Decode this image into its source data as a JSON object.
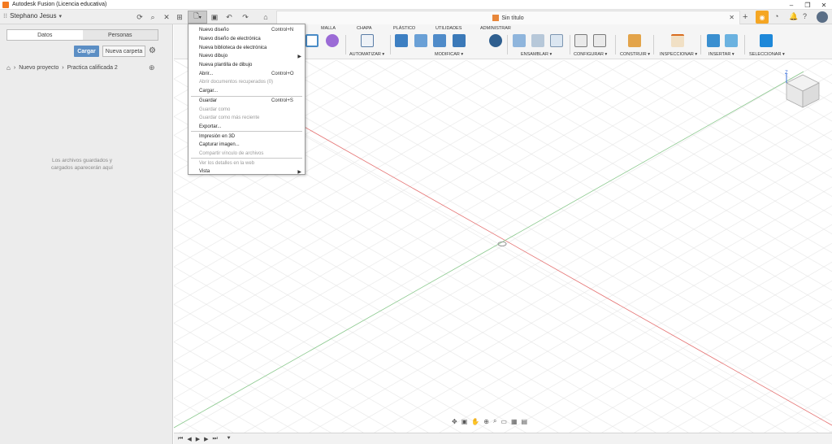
{
  "window": {
    "title": "Autodesk Fusion (Licencia educativa)"
  },
  "appbar": {
    "user_name": "Stephano Jesus",
    "document_title": "Sin título"
  },
  "data_panel": {
    "tabs": [
      "Datos",
      "Personas"
    ],
    "upload_label": "Cargar",
    "new_folder_label": "Nueva carpeta",
    "breadcrumb": [
      "Nuevo proyecto",
      "Practica calificada 2"
    ],
    "empty_message": "Los archivos guardados y cargados aparecerán aquí"
  },
  "toolbar": {
    "tabs": [
      "MALLA",
      "CHAPA",
      "PLÁSTICO",
      "UTILIDADES",
      "ADMINISTRAR"
    ],
    "groups": [
      "AUTOMATIZAR ▾",
      "MODIFICAR ▾",
      "ENSAMBLAR ▾",
      "CONFIGURAR ▾",
      "CONSTRUIR ▾",
      "INSPECCIONAR ▾",
      "INSERTAR ▾",
      "SELECCIONAR ▾"
    ]
  },
  "file_menu": {
    "items": [
      {
        "label": "Nuevo diseño",
        "shortcut": "Control+N",
        "disabled": false
      },
      {
        "label": "Nuevo diseño de electrónica",
        "shortcut": "",
        "disabled": false
      },
      {
        "label": "Nueva biblioteca de electrónica",
        "shortcut": "",
        "disabled": false
      },
      {
        "label": "Nuevo dibujo",
        "shortcut": "",
        "disabled": false,
        "submenu": true
      },
      {
        "label": "Nueva plantilla de dibujo",
        "shortcut": "",
        "disabled": false
      },
      {
        "label": "Abrir...",
        "shortcut": "Control+O",
        "disabled": false
      },
      {
        "label": "Abrir documentos recuperados (0)",
        "shortcut": "",
        "disabled": true
      },
      {
        "label": "Cargar...",
        "shortcut": "",
        "disabled": false,
        "separator_after": true
      },
      {
        "label": "Guardar",
        "shortcut": "Control+S",
        "disabled": false
      },
      {
        "label": "Guardar como",
        "shortcut": "",
        "disabled": true
      },
      {
        "label": "Guardar como más reciente",
        "shortcut": "",
        "disabled": true
      },
      {
        "label": "Exportar...",
        "shortcut": "",
        "disabled": false,
        "separator_after": true
      },
      {
        "label": "Impresión en 3D",
        "shortcut": "",
        "disabled": false
      },
      {
        "label": "Capturar imagen...",
        "shortcut": "",
        "disabled": false
      },
      {
        "label": "Compartir vínculo de archivos",
        "shortcut": "",
        "disabled": true,
        "separator_after": true
      },
      {
        "label": "Ver los detalles en la web",
        "shortcut": "",
        "disabled": true
      },
      {
        "label": "Vista",
        "shortcut": "",
        "disabled": false,
        "submenu": true
      }
    ]
  },
  "viewcube": {
    "axis_label": "Z"
  },
  "colors": {
    "accent_blue": "#5b8ec4",
    "orange": "#f5a623",
    "x_axis": "#e57373",
    "y_axis": "#81c784"
  }
}
